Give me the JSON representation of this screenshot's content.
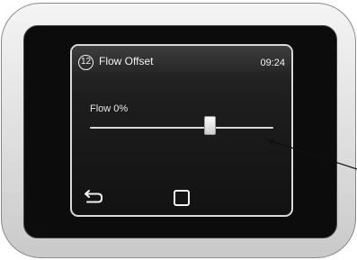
{
  "screen": {
    "step_number": "12",
    "title": "Flow Offset",
    "time": "09:24"
  },
  "parameter": {
    "label": "Flow 0%",
    "slider_fraction": 0.65
  },
  "nav": {
    "back_icon": "back-arrow-icon",
    "home_icon": "square-home-icon"
  },
  "colors": {
    "screen_text": "#f2f2f2",
    "screen_background": "#1a1a1a"
  }
}
